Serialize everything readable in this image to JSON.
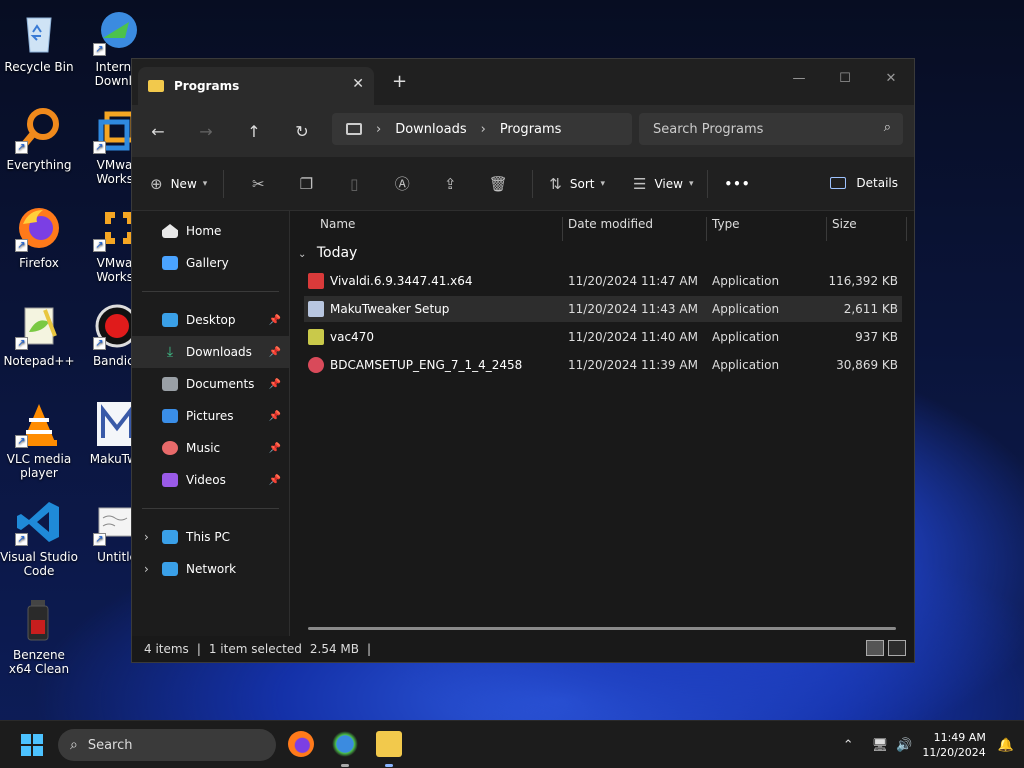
{
  "desktop": {
    "icons": [
      {
        "label": "Recycle Bin",
        "icon": "recycle-bin-icon"
      },
      {
        "label": "Everything",
        "icon": "everything-icon"
      },
      {
        "label": "Firefox",
        "icon": "firefox-icon"
      },
      {
        "label": "Notepad++",
        "icon": "notepadpp-icon"
      },
      {
        "label": "VLC media player",
        "icon": "vlc-icon"
      },
      {
        "label": "Visual Studio Code",
        "icon": "vscode-icon"
      },
      {
        "label": "Benzene x64 Clean",
        "icon": "benzene-icon"
      },
      {
        "label": "Interne Downlo",
        "icon": "idm-icon"
      },
      {
        "label": "VMwar Workst",
        "icon": "vmware-icon"
      },
      {
        "label": "VMwar Workst",
        "icon": "vmware-icon"
      },
      {
        "label": "Bandica",
        "icon": "bandicam-icon"
      },
      {
        "label": "MakuTwe",
        "icon": "makutweaker-icon"
      },
      {
        "label": "Untitle",
        "icon": "document-icon"
      }
    ]
  },
  "explorer": {
    "tab_title": "Programs",
    "tab_close": "✕",
    "new_tab": "+",
    "window_controls": {
      "minimize": "—",
      "maximize": "☐",
      "close": "✕"
    },
    "nav": {
      "back": "←",
      "forward": "→",
      "up": "↑",
      "refresh": "↻"
    },
    "breadcrumb": [
      "Downloads",
      "Programs"
    ],
    "breadcrumb_sep": "›",
    "search_placeholder": "Search Programs",
    "toolbar": {
      "new": "New",
      "sort": "Sort",
      "view": "View",
      "more": "•••",
      "details": "Details"
    },
    "sidebar": {
      "top": [
        {
          "label": "Home",
          "color": "#e8e8e8"
        },
        {
          "label": "Gallery",
          "color": "#4aa3ff"
        }
      ],
      "pinned": [
        {
          "label": "Desktop",
          "color": "#3aa0e8",
          "selected": false
        },
        {
          "label": "Downloads",
          "color": "#3fc38b",
          "selected": true
        },
        {
          "label": "Documents",
          "color": "#9aa0a6",
          "selected": false
        },
        {
          "label": "Pictures",
          "color": "#3a8ee8",
          "selected": false
        },
        {
          "label": "Music",
          "color": "#e86a6a",
          "selected": false
        },
        {
          "label": "Videos",
          "color": "#9a5ae8",
          "selected": false
        }
      ],
      "bottom": [
        {
          "label": "This PC",
          "color": "#3aa0e8"
        },
        {
          "label": "Network",
          "color": "#3aa0e8"
        }
      ]
    },
    "columns": [
      "Name",
      "Date modified",
      "Type",
      "Size"
    ],
    "group": "Today",
    "files": [
      {
        "name": "Vivaldi.6.9.3447.41.x64",
        "date": "11/20/2024 11:47 AM",
        "type": "Application",
        "size": "116,392 KB",
        "color": "#d93a3a",
        "selected": false
      },
      {
        "name": "MakuTweaker Setup",
        "date": "11/20/2024 11:43 AM",
        "type": "Application",
        "size": "2,611 KB",
        "color": "#b8c6e0",
        "selected": true
      },
      {
        "name": "vac470",
        "date": "11/20/2024 11:40 AM",
        "type": "Application",
        "size": "937 KB",
        "color": "#c9c94a",
        "selected": false
      },
      {
        "name": "BDCAMSETUP_ENG_7_1_4_2458",
        "date": "11/20/2024 11:39 AM",
        "type": "Application",
        "size": "30,869 KB",
        "color": "#d94a5a",
        "selected": false
      }
    ],
    "status": {
      "items": "4 items",
      "selected": "1 item selected",
      "size": "2.54 MB"
    }
  },
  "taskbar": {
    "search": "Search",
    "time": "11:49 AM",
    "date": "11/20/2024"
  }
}
